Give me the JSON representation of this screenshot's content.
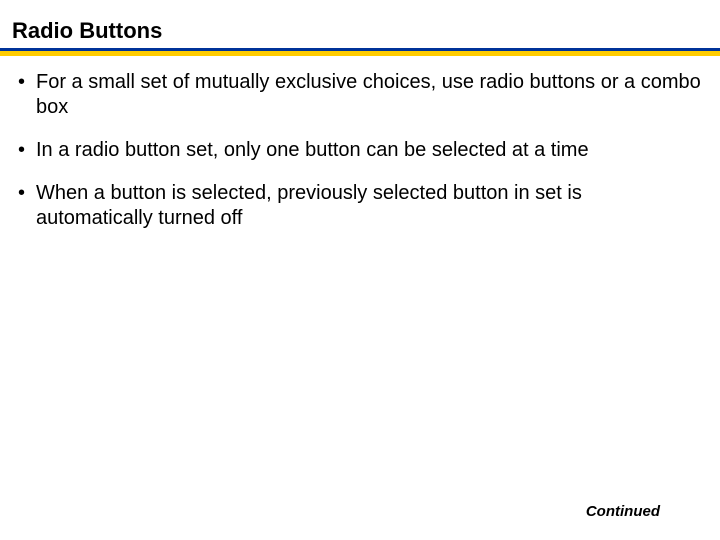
{
  "title": "Radio Buttons",
  "bullets": [
    "For a small set of mutually exclusive choices, use radio buttons or a combo box",
    "In a radio button set, only one button can be selected at a time",
    "When a button is selected, previously selected button in set is automatically turned off"
  ],
  "continued": "Continued"
}
